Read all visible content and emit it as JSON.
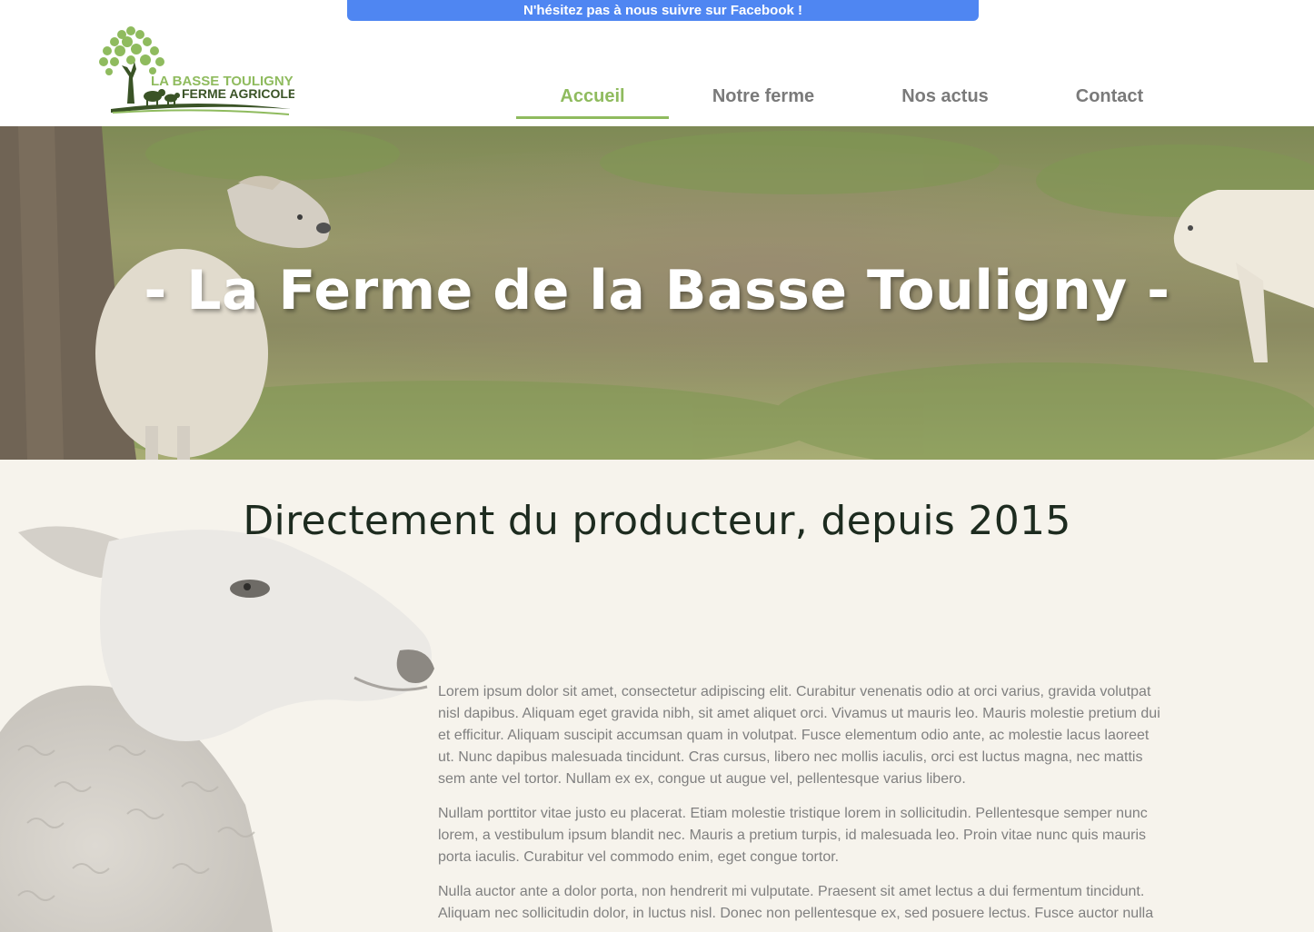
{
  "banner": {
    "text": "N'hésitez pas à nous suivre sur Facebook !"
  },
  "logo": {
    "line1": "LA BASSE TOULIGNY",
    "line2": "FERME AGRICOLE"
  },
  "nav": {
    "items": [
      {
        "label": "Accueil",
        "active": true
      },
      {
        "label": "Notre ferme",
        "active": false
      },
      {
        "label": "Nos actus",
        "active": false
      },
      {
        "label": "Contact",
        "active": false
      }
    ]
  },
  "hero": {
    "title": "- La Ferme de la Basse Touligny -"
  },
  "intro": {
    "title": "Directement du producteur, depuis 2015",
    "paragraphs": [
      "Lorem ipsum dolor sit amet, consectetur adipiscing elit. Curabitur venenatis odio at orci varius, gravida volutpat nisl dapibus. Aliquam eget gravida nibh, sit amet aliquet orci. Vivamus ut mauris leo. Mauris molestie pretium dui et efficitur. Aliquam suscipit accumsan quam in volutpat. Fusce elementum odio ante, ac molestie lacus laoreet ut. Nunc dapibus malesuada tincidunt. Cras cursus, libero nec mollis iaculis, orci est luctus magna, nec mattis sem ante vel tortor. Nullam ex ex, congue ut augue vel, pellentesque varius libero.",
      "Nullam porttitor vitae justo eu placerat. Etiam molestie tristique lorem in sollicitudin. Pellentesque semper nunc lorem, a vestibulum ipsum blandit nec. Mauris a pretium turpis, id malesuada leo. Proin vitae nunc quis mauris porta iaculis. Curabitur vel commodo enim, eget congue tortor.",
      "Nulla auctor ante a dolor porta, non hendrerit mi vulputate. Praesent sit amet lectus a dui fermentum tincidunt. Aliquam nec sollicitudin dolor, in luctus nisl. Donec non pellentesque ex, sed posuere lectus. Fusce auctor nulla"
    ]
  },
  "colors": {
    "accent": "#8fbb5e",
    "banner": "#4f86f2",
    "nav_text": "#7a7a7a",
    "body_text": "#808080",
    "page_bg": "#f6f3ec"
  }
}
